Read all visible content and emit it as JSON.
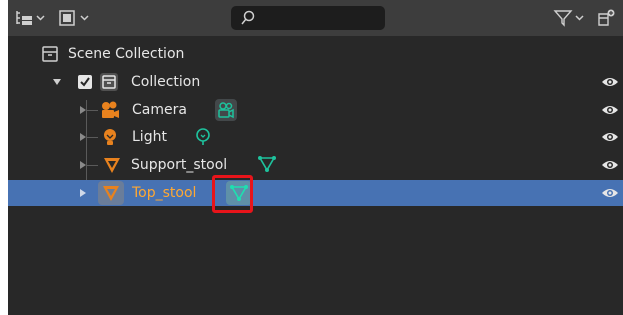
{
  "header": {
    "display_mode_icon": "view-layer-icon",
    "filter_icon": "filter-icon",
    "new_collection_icon": "new-collection-icon",
    "search": {
      "icon": "search-icon",
      "value": ""
    }
  },
  "tree": {
    "scene_collection": {
      "label": "Scene Collection",
      "icon": "scene-collection-icon"
    },
    "collection": {
      "label": "Collection",
      "checked": true,
      "icon": "collection-icon"
    },
    "objects": [
      {
        "label": "Camera",
        "icon": "camera-object-icon",
        "data_icon": "camera-data-icon"
      },
      {
        "label": "Light",
        "icon": "light-object-icon",
        "data_icon": "light-data-icon"
      },
      {
        "label": "Support_stool",
        "icon": "mesh-object-icon",
        "data_icon": "mesh-data-icon"
      },
      {
        "label": "Top_stool",
        "icon": "mesh-object-icon",
        "data_icon": "mesh-data-icon",
        "selected": true
      }
    ]
  },
  "colors": {
    "panel_bg": "#282828",
    "header_bg": "#3d3d3d",
    "selected_row": "#4772b3",
    "selected_text": "#ffa833",
    "object_orange": "#e8821e",
    "data_green": "#1ec29d",
    "highlight_red": "#e8141a"
  }
}
